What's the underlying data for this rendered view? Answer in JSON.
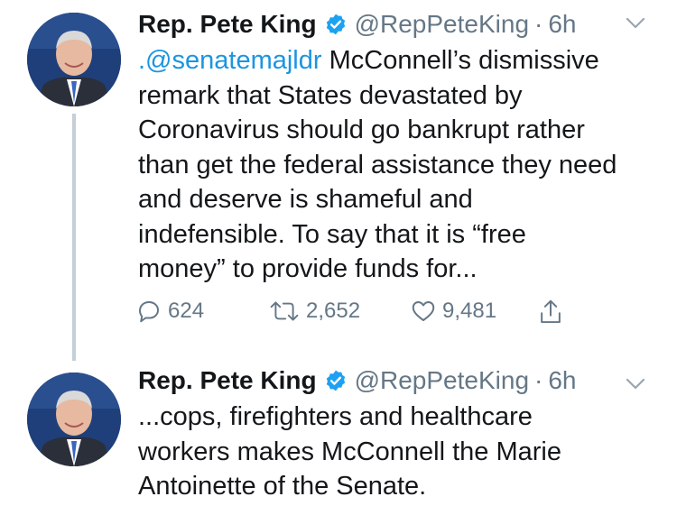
{
  "tweets": [
    {
      "author_name": "Rep. Pete King",
      "handle": "@RepPeteKing",
      "separator": "·",
      "time": "6h",
      "body": {
        "mention": ".@senatemajldr",
        "line1_rest": " McConnell’s dismissive",
        "line2": "remark that States devastated by",
        "line3": "Coronavirus should go bankrupt rather",
        "line4": "than get the federal assistance they need",
        "line5": "and deserve is shameful and",
        "line6": "indefensible. To say that it is “free",
        "line7": "money” to provide funds for..."
      },
      "stats": {
        "replies": "624",
        "retweets": "2,652",
        "likes": "9,481"
      }
    },
    {
      "author_name": "Rep. Pete King",
      "handle": "@RepPeteKing",
      "separator": "·",
      "time": "6h",
      "body": {
        "line1": "...cops, firefighters and healthcare",
        "line2": "workers makes McConnell the Marie",
        "line3": "Antoinette of the Senate."
      }
    }
  ],
  "colors": {
    "link": "#1b95e0",
    "muted": "#657786",
    "verified": "#1da1f2",
    "thread_line": "#c4cfd6"
  },
  "icons": [
    "verified-badge-icon",
    "chevron-down-icon",
    "reply-icon",
    "retweet-icon",
    "like-icon",
    "share-icon"
  ]
}
